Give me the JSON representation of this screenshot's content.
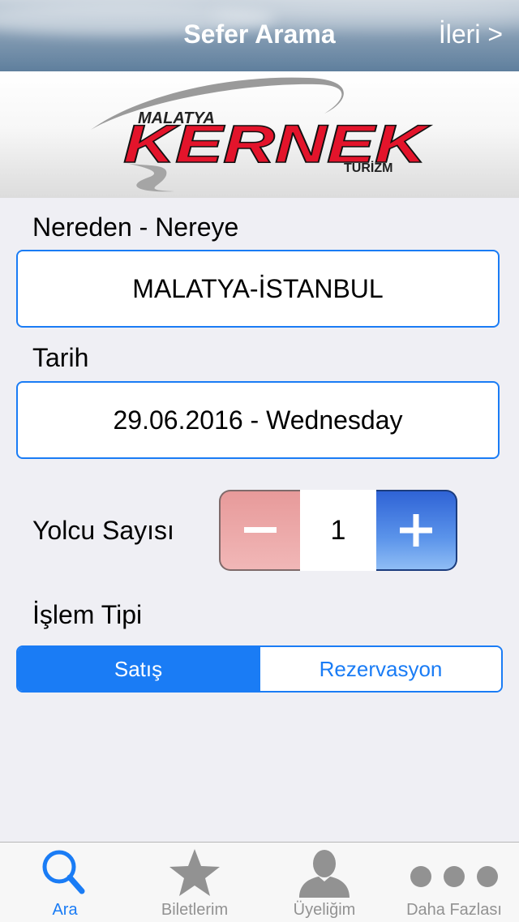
{
  "navbar": {
    "title": "Sefer Arama",
    "next_label": "İleri >"
  },
  "banner": {
    "logo_top": "MALATYA",
    "logo_main": "KERNEK",
    "logo_sub": "TURİZM"
  },
  "form": {
    "route_label": "Nereden - Nereye",
    "route_value": "MALATYA-İSTANBUL",
    "date_label": "Tarih",
    "date_value": "29.06.2016 - Wednesday",
    "passenger_label": "Yolcu Sayısı",
    "passenger_count": "1",
    "transaction_label": "İşlem Tipi",
    "transaction_options": [
      "Satış",
      "Rezervasyon"
    ],
    "transaction_selected": "Satış"
  },
  "tabbar": {
    "items": [
      {
        "label": "Ara",
        "icon": "search-icon",
        "active": true
      },
      {
        "label": "Biletlerim",
        "icon": "star-icon",
        "active": false
      },
      {
        "label": "Üyeliğim",
        "icon": "person-icon",
        "active": false
      },
      {
        "label": "Daha Fazlası",
        "icon": "more-icon",
        "active": false
      }
    ]
  },
  "colors": {
    "accent": "#1a7cf5",
    "inactive_tab": "#929292",
    "logo_red": "#e3142b"
  }
}
